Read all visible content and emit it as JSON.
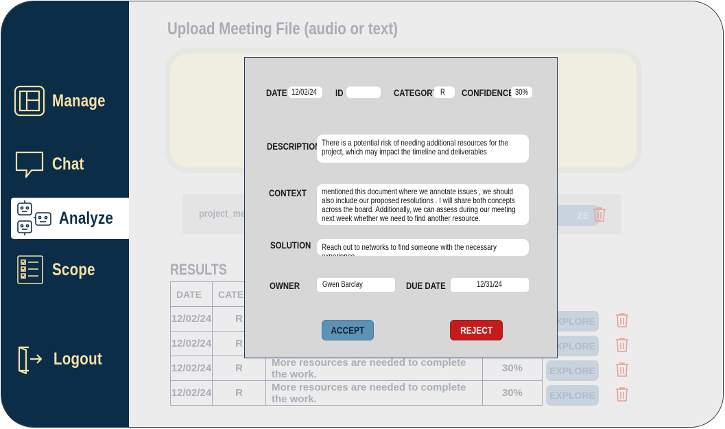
{
  "sidebar": {
    "items": [
      {
        "label": "Manage",
        "icon": "board-icon"
      },
      {
        "label": "Chat",
        "icon": "chat-bubble-icon"
      },
      {
        "label": "Analyze",
        "icon": "robots-icon"
      },
      {
        "label": "Scope",
        "icon": "checklist-icon"
      },
      {
        "label": "Logout",
        "icon": "logout-icon"
      }
    ],
    "active": "Analyze"
  },
  "upload": {
    "title": "Upload Meeting File (audio or text)",
    "file_name": "project_mee",
    "analyze_label": "ZE"
  },
  "results": {
    "title": "RESULTS",
    "headers": [
      "DATE",
      "CATEGOR"
    ],
    "rows": [
      {
        "date": "12/02/24",
        "category": "R",
        "description": "",
        "confidence": "",
        "explore": "EXPLORE"
      },
      {
        "date": "12/02/24",
        "category": "R",
        "description": "",
        "confidence": "",
        "explore": "EXPLORE"
      },
      {
        "date": "12/02/24",
        "category": "R",
        "description": "More resources are needed to complete the work.",
        "confidence": "30%",
        "explore": "EXPLORE"
      },
      {
        "date": "12/02/24",
        "category": "R",
        "description": "More resources are needed to complete the work.",
        "confidence": "30%",
        "explore": "EXPLORE"
      }
    ]
  },
  "modal": {
    "date_label": "DATE",
    "date_value": "12/02/24",
    "id_label": "ID",
    "id_value": "",
    "category_label": "CATEGORY",
    "category_value": "R",
    "confidence_label": "CONFIDENCE",
    "confidence_value": "30%",
    "description_label": "DESCRIPTION",
    "description_value": "There is a potential risk of needing additional resources for the project, which may impact the timeline and deliverables",
    "context_label": "CONTEXT",
    "context_value": "mentioned this document where we annotate issues , we should also include our proposed resolutions . I will share both concepts across the board. Additionally, we can assess during our meeting next week whether we need to find another resource.",
    "solution_label": "SOLUTION",
    "solution_value": "Reach out to networks to find someone with the necessary experience",
    "owner_label": "OWNER",
    "owner_value": "Gwen Barclay",
    "due_date_label": "DUE DATE",
    "due_date_value": "12/31/24",
    "accept_label": "ACCEPT",
    "reject_label": "REJECT"
  },
  "colors": {
    "sidebar_bg": "#0c2d47",
    "nav_text": "#f4e1a6",
    "accept": "#5d91b6",
    "reject": "#c41c1c",
    "trash": "#e8a08f"
  }
}
